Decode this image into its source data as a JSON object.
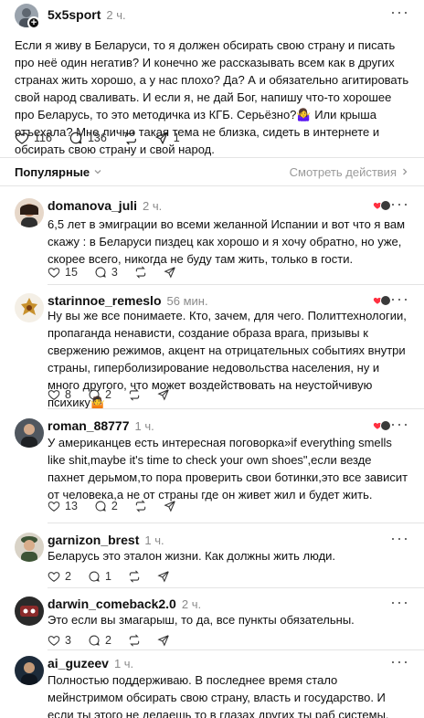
{
  "post": {
    "username": "5x5sport",
    "time": "2 ч.",
    "more": "···",
    "text": "Если я живу в Беларуси, то я должен обсирать свою страну и писать про неё один негатив? И конечно же рассказывать всем как в других странах жить хорошо, а у нас плохо? Да? А и обязательно агитировать свой народ сваливать. И если я, не дай Бог, напишу что-то хорошее про Беларусь, то это методичка из КГБ. Серьёзно?🤷‍♀️ Или крыша отъехала? Мне лично такая тема не близка, сидеть в интернете и обсирать свою страну и свой народ.",
    "likes": "116",
    "comments": "136",
    "shares": "1"
  },
  "sort": {
    "label": "Популярные",
    "actions_link": "Смотреть действия"
  },
  "comments": [
    {
      "username": "domanova_juli",
      "time": "2 ч.",
      "text": "6,5 лет в эмиграции во всеми желанной Испании и вот что я вам скажу : в Беларуси пиздец как хорошо и я хочу обратно, но уже, скорее всего, никогда не буду там жить, только в гости.",
      "likes": "15",
      "replies": "3"
    },
    {
      "username": "starinnoe_remeslo",
      "time": "56 мин.",
      "text": "Ну вы же все понимаете. Кто, зачем, для чего. Политтехнологии, пропаганда ненависти, создание образа врага, призывы к свержению режимов, акцент на отрицательных событиях внутри страны, гиперболизирование недовольства населения, ну и много другого, что может воздействовать на неустойчивую психику🤷",
      "likes": "8",
      "replies": "2"
    },
    {
      "username": "roman_88777",
      "time": "1 ч.",
      "text": "У американцев есть интересная поговорка»if everything smells like shit,maybe it's time to check your own shoes\",если везде пахнет дерьмом,то пора проверить свои ботинки,это все зависит от человека,а не от страны где он живет жил и будет жить.",
      "likes": "13",
      "replies": "2"
    },
    {
      "username": "garnizon_brest",
      "time": "1 ч.",
      "text": "Беларусь это эталон жизни. Как должны жить люди.",
      "likes": "2",
      "replies": "1"
    },
    {
      "username": "darwin_comeback2.0",
      "time": "2 ч.",
      "text": "Это если вы змагарыш, то да, все пункты обязательны.",
      "likes": "3",
      "replies": "2"
    },
    {
      "username": "ai_guzeev",
      "time": "1 ч.",
      "text": "Полностью поддерживаю. В последнее время стало мейнстримом обсирать свою страну, власть и государство. И если ты этого не делаешь то в глазах других ты раб системы.",
      "likes": "",
      "replies": ""
    }
  ],
  "colors": {
    "heart_red": "#ff3040",
    "muted": "#8a8a8a"
  }
}
